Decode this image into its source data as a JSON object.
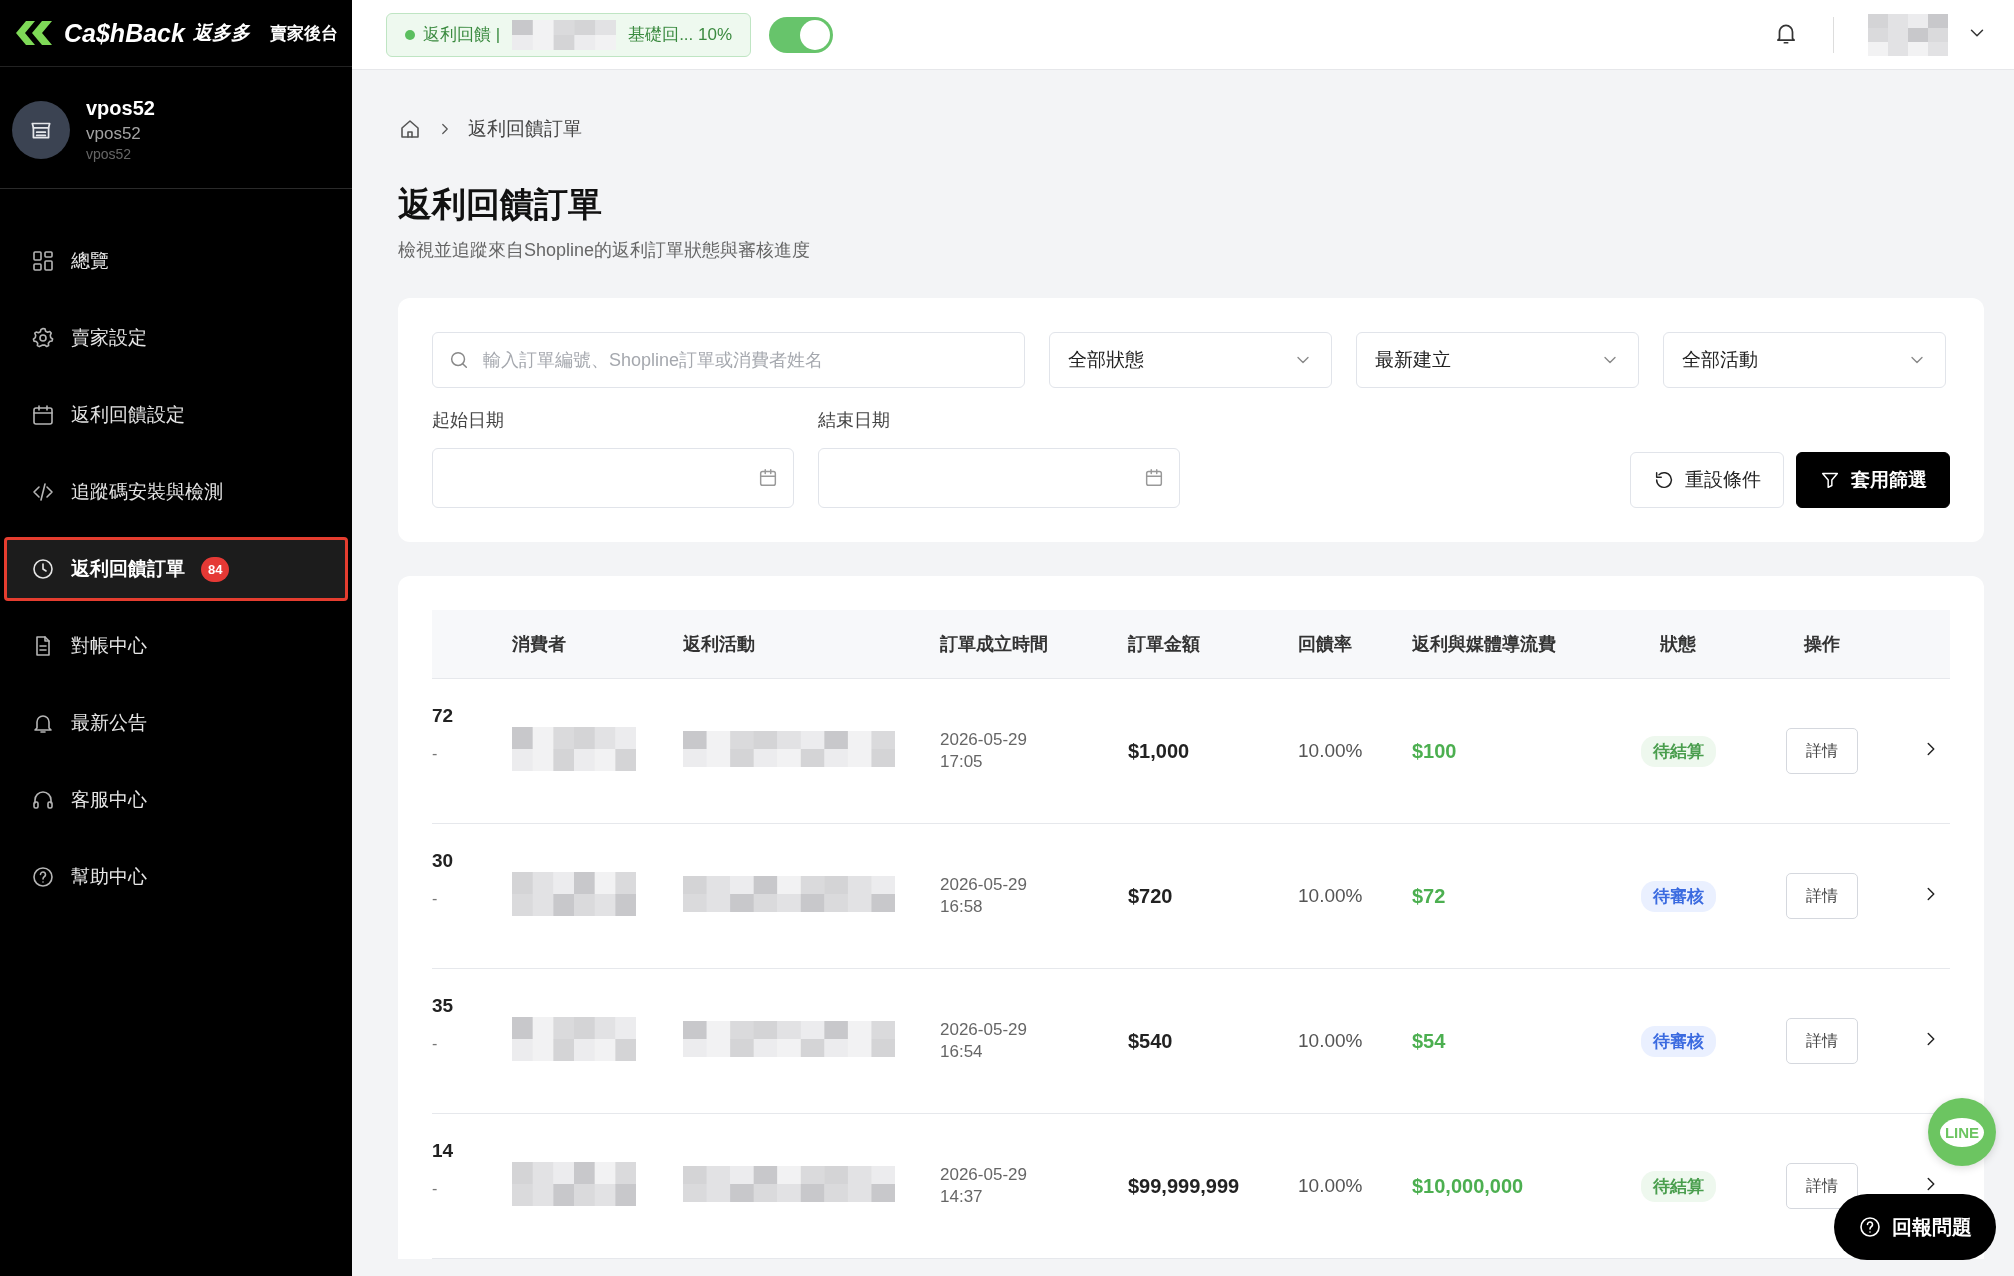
{
  "brand": {
    "name": "Ca$hBack",
    "name_cjk": "返多多",
    "subtitle": "賣家後台"
  },
  "profile": {
    "name": "vpos52",
    "line_2": "vpos52",
    "line_3": "vpos52"
  },
  "nav": [
    {
      "label": "總覽",
      "selected": false
    },
    {
      "label": "賣家設定",
      "selected": false
    },
    {
      "label": "返利回饋設定",
      "selected": false
    },
    {
      "label": "追蹤碼安裝與檢測",
      "selected": false
    },
    {
      "label": "返利回饋訂單",
      "selected": true,
      "badge": "84"
    },
    {
      "label": "對帳中心",
      "selected": false
    },
    {
      "label": "最新公告",
      "selected": false
    },
    {
      "label": "客服中心",
      "selected": false
    },
    {
      "label": "幫助中心",
      "selected": false
    }
  ],
  "topbar": {
    "campaign": {
      "prefix": "返利回饋 |",
      "suffix": "基礎回... 10%"
    },
    "toggle": {
      "on": true
    }
  },
  "breadcrumb": {
    "current": "返利回饋訂單"
  },
  "page": {
    "title": "返利回饋訂單",
    "subtitle": "檢視並追蹤來自Shopline的返利訂單狀態與審核進度"
  },
  "filters": {
    "search": {
      "placeholder": "輸入訂單編號、Shopline訂單或消費者姓名"
    },
    "selects": [
      "全部狀態",
      "最新建立",
      "全部活動"
    ],
    "start_label": "起始日期",
    "end_label": "結束日期",
    "reset_button": "重設條件",
    "apply_button": "套用篩選"
  },
  "table": {
    "columns": [
      "消費者",
      "返利活動",
      "訂單成立時間",
      "訂單金額",
      "回饋率",
      "返利與媒體導流費",
      "狀態",
      "操作"
    ],
    "rows": [
      {
        "order": "72",
        "sub": "-",
        "date": "2026-05-29",
        "time": "17:05",
        "amount": "$1,000",
        "rate": "10.00%",
        "fee": "$100",
        "status": {
          "label": "待結算",
          "kind": "settle"
        },
        "action": "詳情"
      },
      {
        "order": "30",
        "sub": "-",
        "date": "2026-05-29",
        "time": "16:58",
        "amount": "$720",
        "rate": "10.00%",
        "fee": "$72",
        "status": {
          "label": "待審核",
          "kind": "review"
        },
        "action": "詳情"
      },
      {
        "order": "35",
        "sub": "-",
        "date": "2026-05-29",
        "time": "16:54",
        "amount": "$540",
        "rate": "10.00%",
        "fee": "$54",
        "status": {
          "label": "待審核",
          "kind": "review"
        },
        "action": "詳情"
      },
      {
        "order": "14",
        "sub": "-",
        "date": "2026-05-29",
        "time": "14:37",
        "amount": "$99,999,999",
        "rate": "10.00%",
        "fee": "$10,000,000",
        "status": {
          "label": "待結算",
          "kind": "settle"
        },
        "action": "詳情"
      }
    ]
  },
  "floating": {
    "line": "LINE",
    "report": "回報問題"
  }
}
